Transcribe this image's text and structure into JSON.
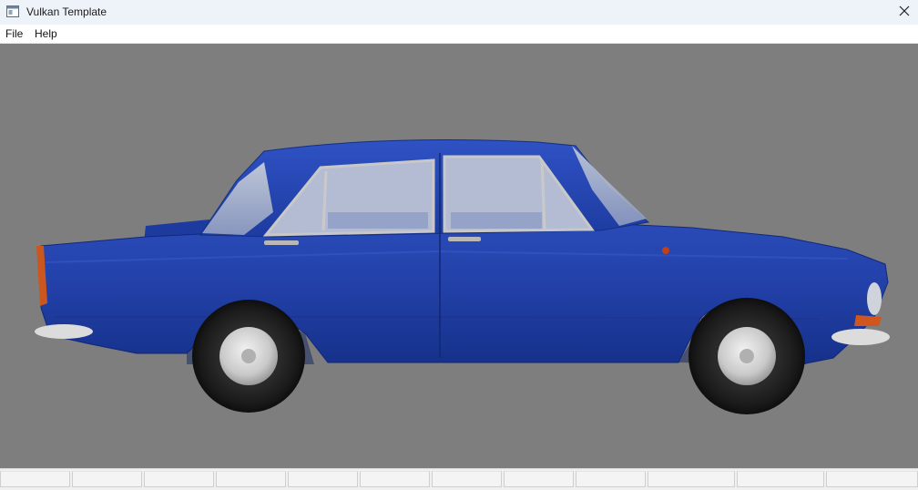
{
  "window": {
    "title": "Vulkan Template",
    "icon": "app-window-icon",
    "close_icon": "close-icon"
  },
  "menu": {
    "items": [
      {
        "label": "File"
      },
      {
        "label": "Help"
      }
    ]
  },
  "viewport": {
    "background_color": "#7e7e7e",
    "model_color": "#1f3fa6",
    "content": "3d-car-render"
  },
  "statusbar": {
    "pane_count": 12
  }
}
